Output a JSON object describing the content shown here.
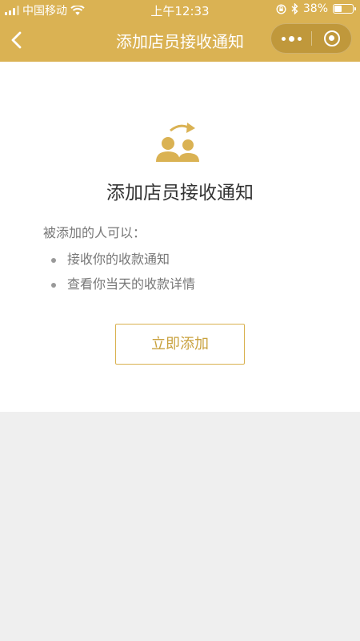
{
  "colors": {
    "header_bg": "#dab253",
    "accent": "#c9a23f",
    "page_bg": "#efefef"
  },
  "status_bar": {
    "carrier": "中国移动",
    "time": "上午12:33",
    "battery": "38%",
    "battery_level": 0.38,
    "icons": [
      "signal-icon",
      "wifi-icon",
      "orientation-lock-icon",
      "bluetooth-icon",
      "battery-icon"
    ]
  },
  "nav": {
    "title": "添加店员接收通知",
    "icons": [
      "back-chevron-icon",
      "more-dots-icon",
      "close-target-icon"
    ]
  },
  "content": {
    "hero_icon": "add-staff-users-icon",
    "title": "添加店员接收通知",
    "intro": "被添加的人可以：",
    "permissions": [
      "接收你的收款通知",
      "查看你当天的收款详情"
    ],
    "button_label": "立即添加"
  }
}
